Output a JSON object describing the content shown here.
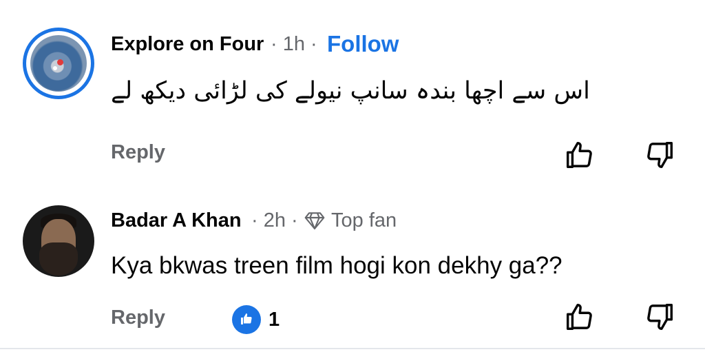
{
  "comments": [
    {
      "author": "Explore on Four",
      "time": "· 1h ·",
      "follow": "Follow",
      "text": "اس سے اچھا بندہ سانپ نیولے کی لڑائی دیکھ لے",
      "reply": "Reply",
      "like_icon": "thumbs-up-icon",
      "dislike_icon": "thumbs-down-icon"
    },
    {
      "author": "Badar A Khan",
      "time": "· 2h ·",
      "badge": "Top fan",
      "badge_icon": "diamond-icon",
      "text": "Kya bkwas treen film hogi kon dekhy ga??",
      "reply": "Reply",
      "reaction_count": "1",
      "reaction_icon": "like-reaction-icon",
      "like_icon": "thumbs-up-icon",
      "dislike_icon": "thumbs-down-icon"
    }
  ],
  "colors": {
    "accent": "#1b74e4",
    "meta": "#65676b",
    "text": "#050505"
  }
}
